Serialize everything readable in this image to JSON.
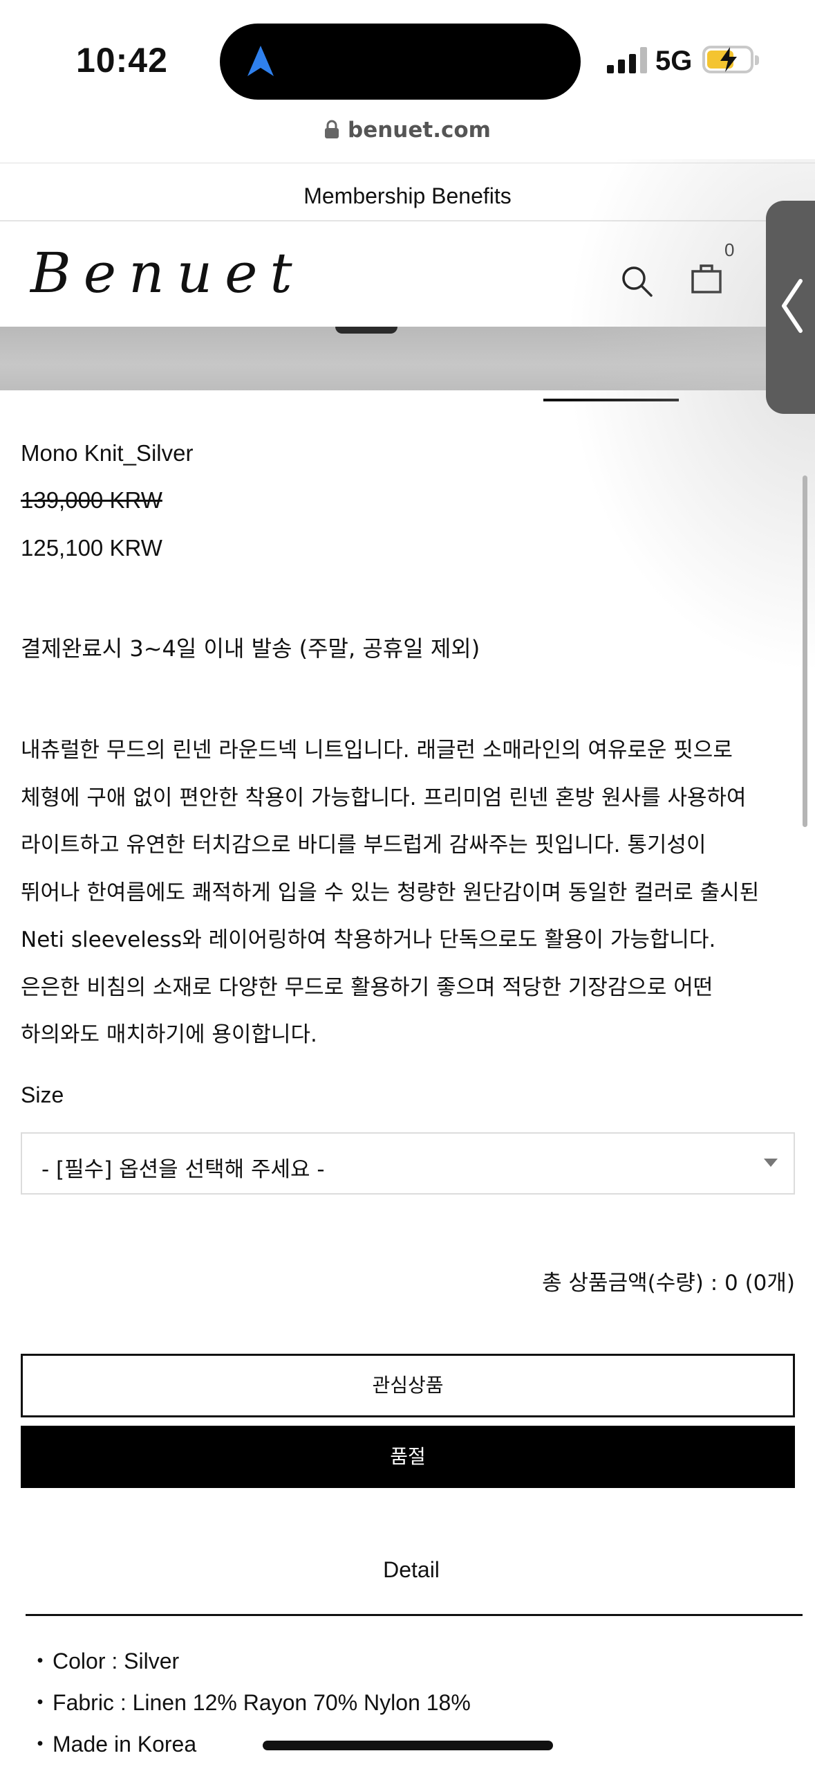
{
  "status_bar": {
    "time": "10:42",
    "network": "5G",
    "url": "benuet.com"
  },
  "banner": {
    "membership_label": "Membership Benefits"
  },
  "header": {
    "logo": "Benuet",
    "cart_count": "0"
  },
  "product": {
    "name": "Mono Knit_Silver",
    "original_price": "139,000 KRW",
    "sale_price": "125,100 KRW",
    "shipping_note": "결제완료시 3~4일 이내 발송 (주말, 공휴일 제외)",
    "description": "내츄럴한 무드의 린넨 라운드넥 니트입니다. 래글런 소매라인의 여유로운 핏으로\n체형에 구애 없이 편안한 착용이 가능합니다. 프리미엄 린넨 혼방 원사를 사용하여\n라이트하고 유연한 터치감으로 바디를 부드럽게 감싸주는 핏입니다. 통기성이\n뛰어나 한여름에도 쾌적하게 입을 수 있는 청량한 원단감이며 동일한 컬러로 출시된\nNeti sleeveless와 레이어링하여 착용하거나 단독으로도 활용이 가능합니다.\n은은한 비침의 소재로 다양한 무드로 활용하기 좋으며 적당한 기장감으로 어떤\n하의와도 매치하기에 용이합니다."
  },
  "options": {
    "size_label": "Size",
    "size_selected": "- [필수] 옵션을 선택해 주세요 -"
  },
  "summary": {
    "total": "총 상품금액(수량) : 0 (0개)"
  },
  "actions": {
    "wishlist_label": "관심상품",
    "soldout_label": "품절"
  },
  "detail": {
    "title": "Detail",
    "items": [
      "Color : Silver",
      "Fabric : Linen 12% Rayon 70% Nylon 18%",
      "Made in Korea"
    ]
  },
  "icons": {
    "navigation": "navigation-arrow-icon",
    "lock": "lock-icon",
    "search": "search-icon",
    "bag": "shopping-bag-icon",
    "menu": "menu-icon",
    "drawer": "chevron-left-icon",
    "select": "caret-down-icon"
  },
  "colors": {
    "accent_blue": "#2f80ed",
    "battery": "#f4c430",
    "button_dark": "#000000"
  }
}
